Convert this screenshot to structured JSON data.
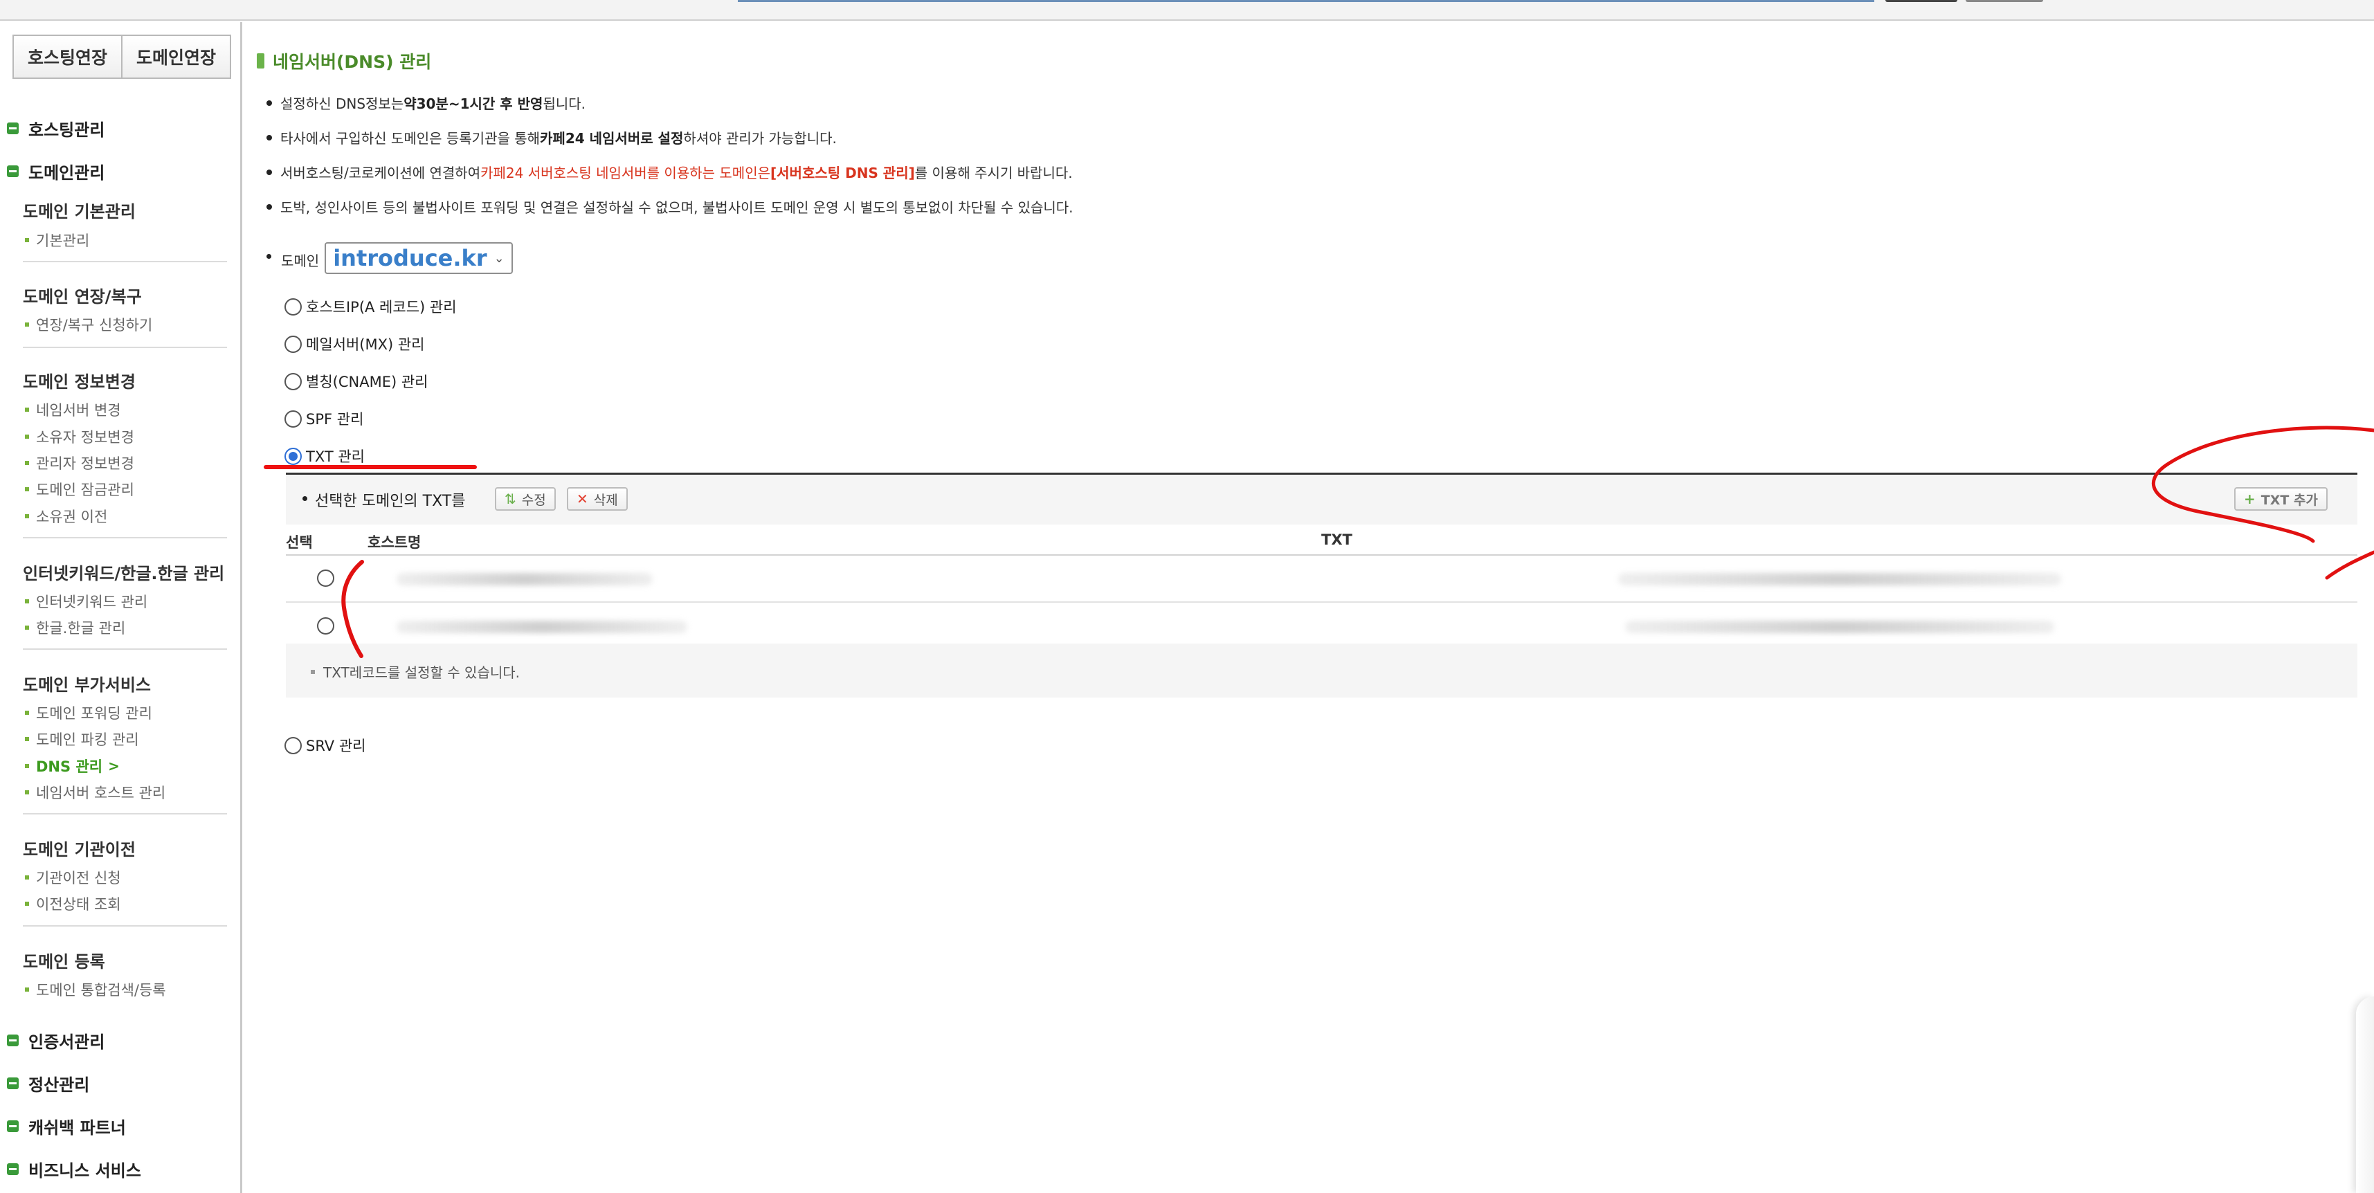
{
  "sidebar": {
    "top_buttons": [
      "호스팅연장",
      "도메인연장"
    ],
    "menus": {
      "hosting": "호스팅관리",
      "domain": "도메인관리",
      "cert": "인증서관리",
      "billing": "정산관리",
      "cashback": "캐쉬백 파트너",
      "business": "비즈니스 서비스"
    },
    "groups": [
      {
        "title": "도메인 기본관리",
        "items": [
          "기본관리"
        ]
      },
      {
        "title": "도메인 연장/복구",
        "items": [
          "연장/복구 신청하기"
        ]
      },
      {
        "title": "도메인 정보변경",
        "items": [
          "네임서버 변경",
          "소유자 정보변경",
          "관리자 정보변경",
          "도메인 잠금관리",
          "소유권 이전"
        ]
      },
      {
        "title": "인터넷키워드/한글.한글 관리",
        "items": [
          "인터넷키워드 관리",
          "한글.한글 관리"
        ]
      },
      {
        "title": "도메인 부가서비스",
        "items": [
          "도메인 포워딩 관리",
          "도메인 파킹 관리",
          "DNS 관리",
          "네임서버 호스트 관리"
        ]
      },
      {
        "title": "도메인 기관이전",
        "items": [
          "기관이전 신청",
          "이전상태 조회"
        ]
      },
      {
        "title": "도메인 등록",
        "items": [
          "도메인 통합검색/등록"
        ]
      }
    ],
    "active_item": "DNS 관리",
    "active_arrow": ">"
  },
  "main": {
    "title": "네임서버(DNS) 관리",
    "notes": {
      "n1_a": "설정하신 DNS정보는 ",
      "n1_b": "약30분~1시간 후 반영",
      "n1_c": "됩니다.",
      "n2_a": "타사에서 구입하신 도메인은 등록기관을 통해 ",
      "n2_b": "카페24 네임서버로 설정",
      "n2_c": "하셔야 관리가 가능합니다.",
      "n3_a": "서버호스팅/코로케이션에 연결하여 ",
      "n3_b": "카페24 서버호스팅 네임서버를 이용하는 도메인은",
      "n3_c": "[서버호스팅 DNS 관리]",
      "n3_d": "를 이용해 주시기 바랍니다.",
      "n4": "도박, 성인사이트 등의 불법사이트 포워딩 및 연결은 설정하실 수 없으며, 불법사이트 도메인 운영 시 별도의 통보없이 차단될 수 있습니다."
    },
    "domain_label": "도메인",
    "domain_value": "introduce.kr",
    "record_types": [
      "호스트IP(A 레코드) 관리",
      "메일서버(MX) 관리",
      "별칭(CNAME) 관리",
      "SPF 관리",
      "TXT 관리",
      "SRV 관리"
    ],
    "selected_record_type": "TXT 관리",
    "txt_panel": {
      "heading": "선택한 도메인의 TXT를",
      "edit_label": "수정",
      "delete_label": "삭제",
      "add_label": "TXT 추가",
      "columns": [
        "선택",
        "호스트명",
        "TXT"
      ],
      "footnote": "TXT레코드를 설정할 수 있습니다."
    }
  },
  "icons": {
    "menu_bullet": "square-minus-icon",
    "edit": "edit-arrows-icon",
    "delete": "x-icon",
    "add": "plus-icon"
  },
  "colors": {
    "accent_green": "#3a9a3a",
    "title_green": "#4a8b2a",
    "warn_red": "#d8341e",
    "domain_blue": "#3a7fc9",
    "annotation_red": "#e11111"
  }
}
